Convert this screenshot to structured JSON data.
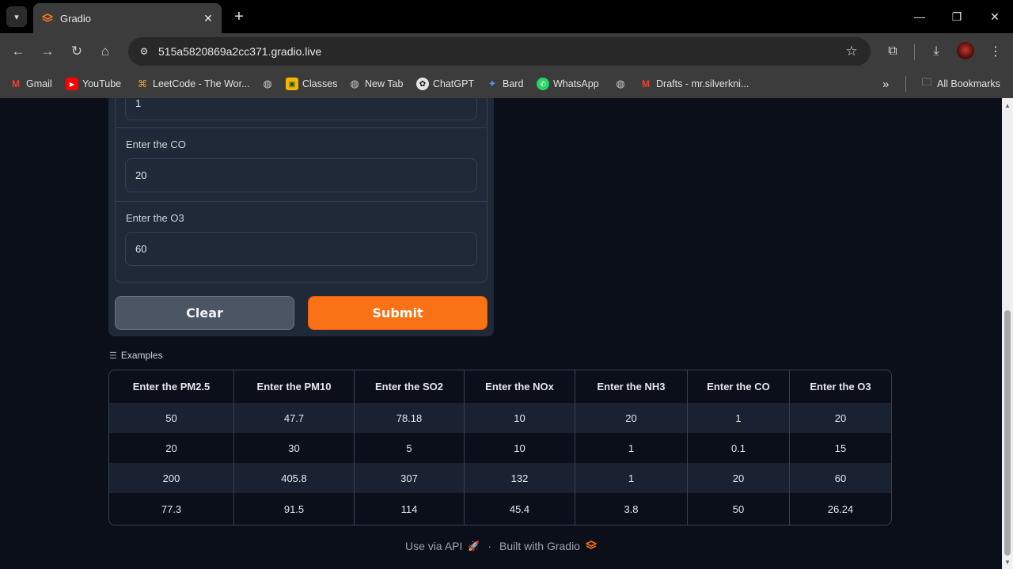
{
  "browser": {
    "tab_title": "Gradio",
    "url": "515a5820869a2cc371.gradio.live",
    "bookmarks": [
      {
        "label": "Gmail",
        "icon": "gmail-icon"
      },
      {
        "label": "YouTube",
        "icon": "youtube-icon"
      },
      {
        "label": "LeetCode - The Wor...",
        "icon": "leetcode-icon"
      },
      {
        "label": "",
        "icon": "globe-icon"
      },
      {
        "label": "Classes",
        "icon": "classroom-icon"
      },
      {
        "label": "New Tab",
        "icon": "globe-icon"
      },
      {
        "label": "ChatGPT",
        "icon": "chatgpt-icon"
      },
      {
        "label": "Bard",
        "icon": "bard-icon"
      },
      {
        "label": "WhatsApp",
        "icon": "whatsapp-icon"
      },
      {
        "label": "",
        "icon": "globe-icon"
      },
      {
        "label": "Drafts - mr.silverkni...",
        "icon": "gmail-icon"
      }
    ],
    "more_bookmarks": "»",
    "all_bookmarks": "All Bookmarks"
  },
  "form": {
    "fields": [
      {
        "label": "",
        "value": "1"
      },
      {
        "label": "Enter the CO",
        "value": "20"
      },
      {
        "label": "Enter the O3",
        "value": "60"
      }
    ],
    "clear_label": "Clear",
    "submit_label": "Submit"
  },
  "examples": {
    "label": "Examples",
    "headers": [
      "Enter the PM2.5",
      "Enter the PM10",
      "Enter the SO2",
      "Enter the NOx",
      "Enter the NH3",
      "Enter the CO",
      "Enter the O3"
    ],
    "rows": [
      [
        "50",
        "47.7",
        "78.18",
        "10",
        "20",
        "1",
        "20"
      ],
      [
        "20",
        "30",
        "5",
        "10",
        "1",
        "0.1",
        "15"
      ],
      [
        "200",
        "405.8",
        "307",
        "132",
        "1",
        "20",
        "60"
      ],
      [
        "77.3",
        "91.5",
        "114",
        "45.4",
        "3.8",
        "50",
        "26.24"
      ]
    ]
  },
  "footer": {
    "api_label": "Use via API",
    "separator": "·",
    "built_label": "Built with Gradio"
  },
  "colors": {
    "page_bg": "#0b0f19",
    "panel_bg": "#1f2937",
    "accent": "#f97316"
  }
}
